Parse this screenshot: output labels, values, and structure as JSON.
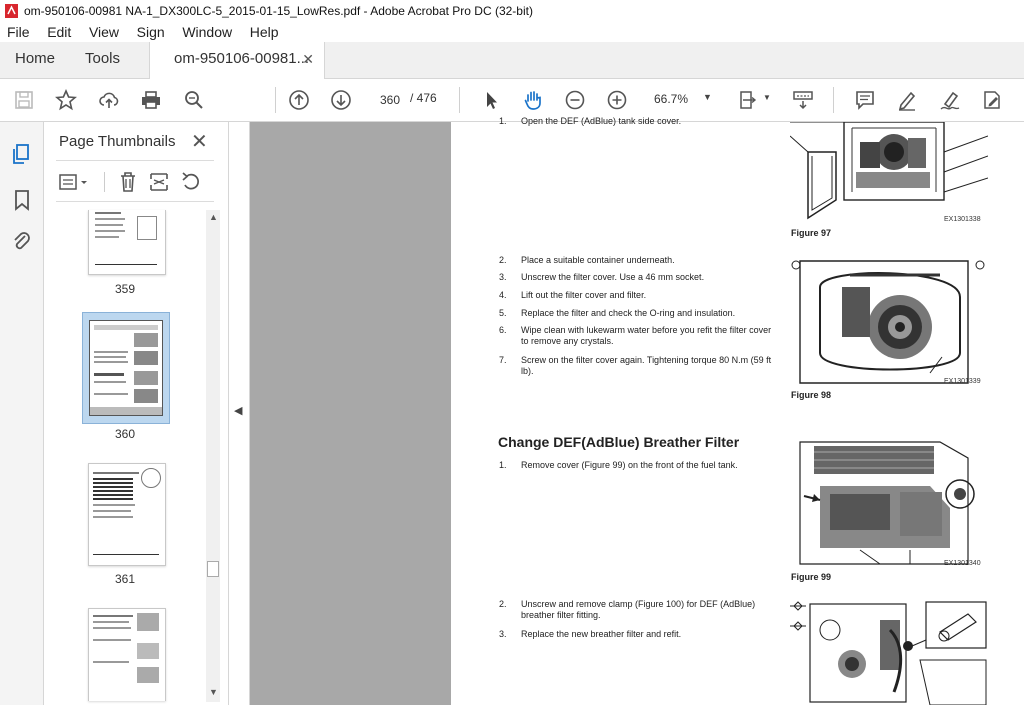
{
  "window": {
    "title": "om-950106-00981 NA-1_DX300LC-5_2015-01-15_LowRes.pdf - Adobe Acrobat Pro DC (32-bit)"
  },
  "menu": [
    "File",
    "Edit",
    "View",
    "Sign",
    "Window",
    "Help"
  ],
  "tabs": {
    "home": "Home",
    "tools": "Tools",
    "document": "om-950106-00981..."
  },
  "toolbar": {
    "current_page": "360",
    "total_pages": "/ 476",
    "zoom": "66.7%"
  },
  "sidebar": {
    "panel_title": "Page Thumbnails",
    "thumbnails": [
      {
        "label": "359"
      },
      {
        "label": "360"
      },
      {
        "label": "361"
      }
    ]
  },
  "document": {
    "step1_partial": "Open the DEF (AdBlue) tank side cover.",
    "steps_a": [
      {
        "num": "2.",
        "text": "Place a suitable container underneath."
      },
      {
        "num": "3.",
        "text": "Unscrew the filter cover. Use a 46 mm socket."
      },
      {
        "num": "4.",
        "text": "Lift out the filter cover and filter."
      },
      {
        "num": "5.",
        "text": "Replace the filter and check the O-ring and insulation."
      },
      {
        "num": "6.",
        "text": "Wipe clean with lukewarm water before you refit the filter cover to remove any crystals."
      },
      {
        "num": "7.",
        "text": "Screw on the filter cover again. Tightening torque 80 N.m (59 ft lb)."
      }
    ],
    "heading": "Change DEF(AdBlue) Breather Filter",
    "steps_b": [
      {
        "num": "1.",
        "text": "Remove cover (Figure 99) on the front of the fuel tank."
      }
    ],
    "steps_c": [
      {
        "num": "2.",
        "text": "Unscrew and remove clamp (Figure 100) for DEF (AdBlue) breather filter fitting."
      },
      {
        "num": "3.",
        "text": "Replace the new breather filter and refit."
      }
    ],
    "figures": [
      {
        "caption": "Figure 97",
        "code": "EX1301338"
      },
      {
        "caption": "Figure 98",
        "code": "EX1301339"
      },
      {
        "caption": "Figure 99",
        "code": "EX1301340"
      }
    ]
  },
  "colors": {
    "accent": "#1a73c9",
    "doc_bg": "#a8a8a8",
    "selected_thumb": "#bcd7ef"
  }
}
